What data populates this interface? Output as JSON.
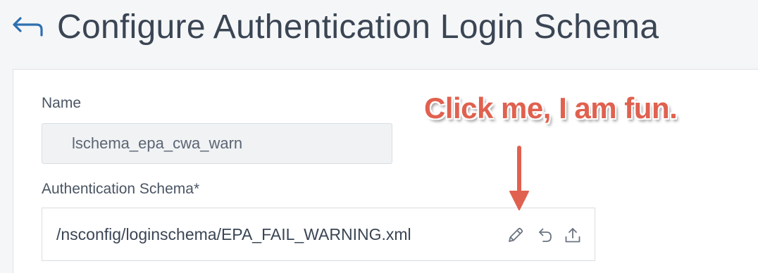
{
  "header": {
    "title": "Configure Authentication Login Schema",
    "back_icon": "back-arrow-icon"
  },
  "form": {
    "name_label": "Name",
    "name_value": "lschema_epa_cwa_warn",
    "schema_label": "Authentication Schema*",
    "schema_value": "/nsconfig/loginschema/EPA_FAIL_WARNING.xml",
    "actions": [
      {
        "icon": "edit-icon"
      },
      {
        "icon": "undo-icon"
      },
      {
        "icon": "upload-icon"
      }
    ]
  },
  "annotation": {
    "callout_text": "Click me, I am fun.",
    "callout_color": "#e0614f"
  }
}
